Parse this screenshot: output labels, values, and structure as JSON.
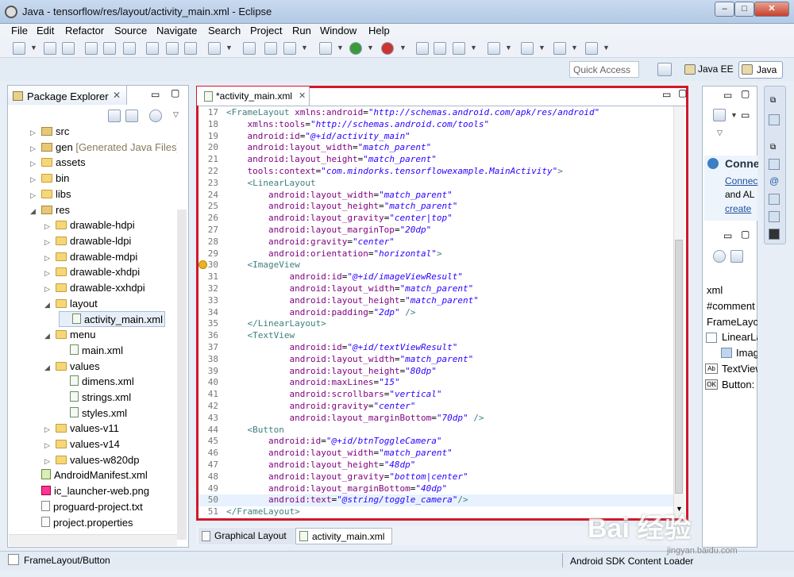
{
  "window": {
    "title": "Java - tensorflow/res/layout/activity_main.xml - Eclipse",
    "buttons": {
      "minimize": "–",
      "maximize": "□",
      "close": "✕"
    }
  },
  "menu": [
    "File",
    "Edit",
    "Refactor",
    "Source",
    "Navigate",
    "Search",
    "Project",
    "Run",
    "Window",
    "Help"
  ],
  "quick_access": {
    "placeholder": "Quick Access"
  },
  "perspectives": {
    "java_ee": "Java EE",
    "java": "Java"
  },
  "package_explorer": {
    "title": "Package Explorer",
    "items": [
      {
        "label": "src",
        "type": "pkg",
        "indent": 0,
        "toggle": "▷"
      },
      {
        "label": "gen",
        "note": "[Generated Java Files]",
        "type": "pkg",
        "indent": 0,
        "toggle": "▷"
      },
      {
        "label": "assets",
        "type": "folder",
        "indent": 0,
        "toggle": "▷"
      },
      {
        "label": "bin",
        "type": "folder",
        "indent": 0,
        "toggle": "▷"
      },
      {
        "label": "libs",
        "type": "folder",
        "indent": 0,
        "toggle": "▷"
      },
      {
        "label": "res",
        "type": "pkg",
        "indent": 0,
        "toggle": "◢"
      },
      {
        "label": "drawable-hdpi",
        "type": "folder",
        "indent": 1,
        "toggle": "▷"
      },
      {
        "label": "drawable-ldpi",
        "type": "folder",
        "indent": 1,
        "toggle": "▷"
      },
      {
        "label": "drawable-mdpi",
        "type": "folder",
        "indent": 1,
        "toggle": "▷"
      },
      {
        "label": "drawable-xhdpi",
        "type": "folder",
        "indent": 1,
        "toggle": "▷"
      },
      {
        "label": "drawable-xxhdpi",
        "type": "folder",
        "indent": 1,
        "toggle": "▷"
      },
      {
        "label": "layout",
        "type": "folder",
        "indent": 1,
        "toggle": "◢"
      },
      {
        "label": "activity_main.xml",
        "type": "xml",
        "indent": 2,
        "toggle": "",
        "selected": true
      },
      {
        "label": "menu",
        "type": "folder",
        "indent": 1,
        "toggle": "◢"
      },
      {
        "label": "main.xml",
        "type": "xml",
        "indent": 2,
        "toggle": ""
      },
      {
        "label": "values",
        "type": "folder",
        "indent": 1,
        "toggle": "◢"
      },
      {
        "label": "dimens.xml",
        "type": "xml",
        "indent": 2,
        "toggle": ""
      },
      {
        "label": "strings.xml",
        "type": "xml",
        "indent": 2,
        "toggle": ""
      },
      {
        "label": "styles.xml",
        "type": "xml",
        "indent": 2,
        "toggle": ""
      },
      {
        "label": "values-v11",
        "type": "folder",
        "indent": 1,
        "toggle": "▷"
      },
      {
        "label": "values-v14",
        "type": "folder",
        "indent": 1,
        "toggle": "▷"
      },
      {
        "label": "values-w820dp",
        "type": "folder",
        "indent": 1,
        "toggle": "▷"
      },
      {
        "label": "AndroidManifest.xml",
        "type": "android",
        "indent": 0,
        "toggle": ""
      },
      {
        "label": "ic_launcher-web.png",
        "type": "img",
        "indent": 0,
        "toggle": ""
      },
      {
        "label": "proguard-project.txt",
        "type": "file",
        "indent": 0,
        "toggle": ""
      },
      {
        "label": "project.properties",
        "type": "file",
        "indent": 0,
        "toggle": ""
      }
    ]
  },
  "editor": {
    "tab_label": "*activity_main.xml",
    "bottom_tabs": [
      "Graphical Layout",
      "activity_main.xml"
    ],
    "lines": [
      {
        "n": "17",
        "parts": [
          [
            "tg",
            "<FrameLayout "
          ],
          [
            "an",
            "xmlns:android"
          ],
          [
            "",
            "="
          ],
          [
            "av",
            "\"http://schemas.android.com/apk/res/android\""
          ]
        ]
      },
      {
        "n": "18",
        "parts": [
          [
            "",
            "    "
          ],
          [
            "an",
            "xmlns:tools"
          ],
          [
            "",
            "="
          ],
          [
            "av",
            "\"http://schemas.android.com/tools\""
          ]
        ]
      },
      {
        "n": "19",
        "parts": [
          [
            "",
            "    "
          ],
          [
            "an",
            "android:id"
          ],
          [
            "",
            "="
          ],
          [
            "av",
            "\"@+id/activity_main\""
          ]
        ]
      },
      {
        "n": "20",
        "parts": [
          [
            "",
            "    "
          ],
          [
            "an",
            "android:layout_width"
          ],
          [
            "",
            "="
          ],
          [
            "av",
            "\"match_parent\""
          ]
        ]
      },
      {
        "n": "21",
        "parts": [
          [
            "",
            "    "
          ],
          [
            "an",
            "android:layout_height"
          ],
          [
            "",
            "="
          ],
          [
            "av",
            "\"match_parent\""
          ]
        ]
      },
      {
        "n": "22",
        "parts": [
          [
            "",
            "    "
          ],
          [
            "an",
            "tools:context"
          ],
          [
            "",
            "="
          ],
          [
            "av",
            "\"com.mindorks.tensorflowexample.MainActivity\""
          ],
          [
            "tg",
            ">"
          ]
        ]
      },
      {
        "n": "23",
        "parts": [
          [
            "",
            "    "
          ],
          [
            "tg",
            "<LinearLayout"
          ]
        ]
      },
      {
        "n": "24",
        "parts": [
          [
            "",
            "        "
          ],
          [
            "an",
            "android:layout_width"
          ],
          [
            "",
            "="
          ],
          [
            "av",
            "\"match_parent\""
          ]
        ]
      },
      {
        "n": "25",
        "parts": [
          [
            "",
            "        "
          ],
          [
            "an",
            "android:layout_height"
          ],
          [
            "",
            "="
          ],
          [
            "av",
            "\"match_parent\""
          ]
        ]
      },
      {
        "n": "26",
        "parts": [
          [
            "",
            "        "
          ],
          [
            "an",
            "android:layout_gravity"
          ],
          [
            "",
            "="
          ],
          [
            "av",
            "\"center|top\""
          ]
        ]
      },
      {
        "n": "27",
        "parts": [
          [
            "",
            "        "
          ],
          [
            "an",
            "android:layout_marginTop"
          ],
          [
            "",
            "="
          ],
          [
            "av",
            "\"20dp\""
          ]
        ]
      },
      {
        "n": "28",
        "parts": [
          [
            "",
            "        "
          ],
          [
            "an",
            "android:gravity"
          ],
          [
            "",
            "="
          ],
          [
            "av",
            "\"center\""
          ]
        ]
      },
      {
        "n": "29",
        "parts": [
          [
            "",
            "        "
          ],
          [
            "an",
            "android:orientation"
          ],
          [
            "",
            "="
          ],
          [
            "av",
            "\"horizontal\""
          ],
          [
            "tg",
            ">"
          ]
        ]
      },
      {
        "n": "30",
        "parts": [
          [
            "",
            "    "
          ],
          [
            "tg",
            "<ImageView"
          ]
        ]
      },
      {
        "n": "31",
        "parts": [
          [
            "",
            "            "
          ],
          [
            "an",
            "android:id"
          ],
          [
            "",
            "="
          ],
          [
            "av",
            "\"@+id/imageViewResult\""
          ]
        ]
      },
      {
        "n": "32",
        "parts": [
          [
            "",
            "            "
          ],
          [
            "an",
            "android:layout_width"
          ],
          [
            "",
            "="
          ],
          [
            "av",
            "\"match_parent\""
          ]
        ]
      },
      {
        "n": "33",
        "parts": [
          [
            "",
            "            "
          ],
          [
            "an",
            "android:layout_height"
          ],
          [
            "",
            "="
          ],
          [
            "av",
            "\"match_parent\""
          ]
        ]
      },
      {
        "n": "34",
        "parts": [
          [
            "",
            "            "
          ],
          [
            "an",
            "android:padding"
          ],
          [
            "",
            "="
          ],
          [
            "av",
            "\"2dp\""
          ],
          [
            "tg",
            " />"
          ]
        ]
      },
      {
        "n": "35",
        "parts": [
          [
            "",
            "    "
          ],
          [
            "tg",
            "</LinearLayout>"
          ]
        ]
      },
      {
        "n": "36",
        "parts": [
          [
            "",
            "    "
          ],
          [
            "tg",
            "<TextView"
          ]
        ]
      },
      {
        "n": "37",
        "parts": [
          [
            "",
            "            "
          ],
          [
            "an",
            "android:id"
          ],
          [
            "",
            "="
          ],
          [
            "av",
            "\"@+id/textViewResult\""
          ]
        ]
      },
      {
        "n": "38",
        "parts": [
          [
            "",
            "            "
          ],
          [
            "an",
            "android:layout_width"
          ],
          [
            "",
            "="
          ],
          [
            "av",
            "\"match_parent\""
          ]
        ]
      },
      {
        "n": "39",
        "parts": [
          [
            "",
            "            "
          ],
          [
            "an",
            "android:layout_height"
          ],
          [
            "",
            "="
          ],
          [
            "av",
            "\"80dp\""
          ]
        ]
      },
      {
        "n": "40",
        "parts": [
          [
            "",
            "            "
          ],
          [
            "an",
            "android:maxLines"
          ],
          [
            "",
            "="
          ],
          [
            "av",
            "\"15\""
          ]
        ]
      },
      {
        "n": "41",
        "parts": [
          [
            "",
            "            "
          ],
          [
            "an",
            "android:scrollbars"
          ],
          [
            "",
            "="
          ],
          [
            "av",
            "\"vertical\""
          ]
        ]
      },
      {
        "n": "42",
        "parts": [
          [
            "",
            "            "
          ],
          [
            "an",
            "android:gravity"
          ],
          [
            "",
            "="
          ],
          [
            "av",
            "\"center\""
          ]
        ]
      },
      {
        "n": "43",
        "parts": [
          [
            "",
            "            "
          ],
          [
            "an",
            "android:layout_marginBottom"
          ],
          [
            "",
            "="
          ],
          [
            "av",
            "\"70dp\""
          ],
          [
            "tg",
            " />"
          ]
        ]
      },
      {
        "n": "44",
        "parts": [
          [
            "",
            "    "
          ],
          [
            "tg",
            "<Button"
          ]
        ]
      },
      {
        "n": "45",
        "parts": [
          [
            "",
            "        "
          ],
          [
            "an",
            "android:id"
          ],
          [
            "",
            "="
          ],
          [
            "av",
            "\"@+id/btnToggleCamera\""
          ]
        ]
      },
      {
        "n": "46",
        "parts": [
          [
            "",
            "        "
          ],
          [
            "an",
            "android:layout_width"
          ],
          [
            "",
            "="
          ],
          [
            "av",
            "\"match_parent\""
          ]
        ]
      },
      {
        "n": "47",
        "parts": [
          [
            "",
            "        "
          ],
          [
            "an",
            "android:layout_height"
          ],
          [
            "",
            "="
          ],
          [
            "av",
            "\"48dp\""
          ]
        ]
      },
      {
        "n": "48",
        "parts": [
          [
            "",
            "        "
          ],
          [
            "an",
            "android:layout_gravity"
          ],
          [
            "",
            "="
          ],
          [
            "av",
            "\"bottom|center\""
          ]
        ]
      },
      {
        "n": "49",
        "parts": [
          [
            "",
            "        "
          ],
          [
            "an",
            "android:layout_marginBottom"
          ],
          [
            "",
            "="
          ],
          [
            "av",
            "\"40dp\""
          ]
        ]
      },
      {
        "n": "50",
        "parts": [
          [
            "",
            "        "
          ],
          [
            "an",
            "android:text"
          ],
          [
            "",
            "="
          ],
          [
            "av",
            "\"@string/toggle_camera\""
          ],
          [
            "tg",
            "/>"
          ]
        ],
        "current": true
      },
      {
        "n": "51",
        "parts": [
          [
            "tg",
            "</FrameLayout>"
          ]
        ]
      }
    ]
  },
  "right_panel": {
    "connect_title": "Conne",
    "connect_link": "Connec",
    "connect_text": "and AL",
    "connect_create": "create",
    "outline": [
      "xml",
      "#comment",
      "FrameLayo",
      "LinearLa",
      "Imag",
      "TextView",
      "Button:"
    ]
  },
  "status": {
    "left": "FrameLayout/Button",
    "right": "Android SDK Content Loader"
  },
  "watermark": {
    "text": "Bai 经验",
    "url": "jingyan.baidu.com"
  }
}
